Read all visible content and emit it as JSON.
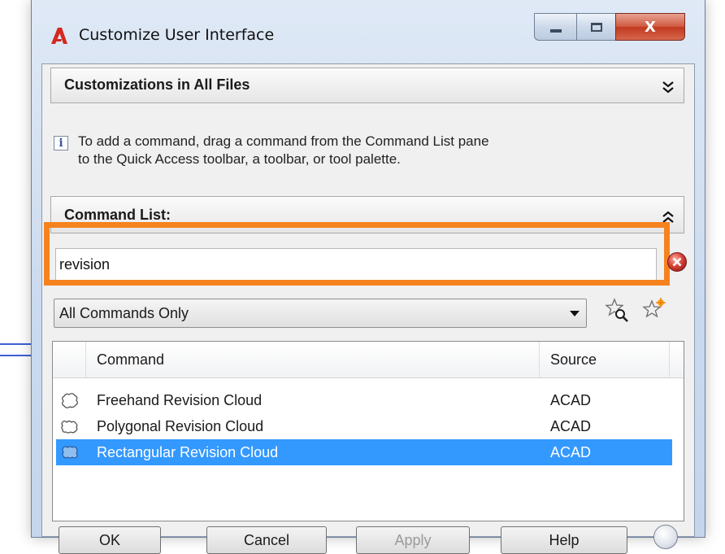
{
  "window": {
    "title": "Customize User Interface",
    "close_glyph": "X"
  },
  "customizations_panel": {
    "title": "Customizations in All Files"
  },
  "info": {
    "icon": "i",
    "line1": "To add a command, drag a command from the Command List pane",
    "line2": "to the Quick Access toolbar, a toolbar, or tool palette."
  },
  "command_list": {
    "title": "Command List:",
    "search_value": "revision",
    "filter_selected": "All Commands Only",
    "columns": {
      "command": "Command",
      "source": "Source"
    },
    "rows": [
      {
        "command": "Freehand Revision Cloud",
        "source": "ACAD",
        "icon": "freehand-cloud-icon",
        "selected": false
      },
      {
        "command": "Polygonal Revision Cloud",
        "source": "ACAD",
        "icon": "polygonal-cloud-icon",
        "selected": false
      },
      {
        "command": "Rectangular Revision Cloud",
        "source": "ACAD",
        "icon": "rectangular-cloud-icon",
        "selected": true
      }
    ]
  },
  "buttons": {
    "ok": "OK",
    "cancel": "Cancel",
    "apply": "Apply",
    "help": "Help"
  },
  "colors": {
    "highlight": "#f5821f",
    "selection": "#3399ff",
    "close_button": "#c23a20",
    "app_logo": "#d4291f"
  }
}
